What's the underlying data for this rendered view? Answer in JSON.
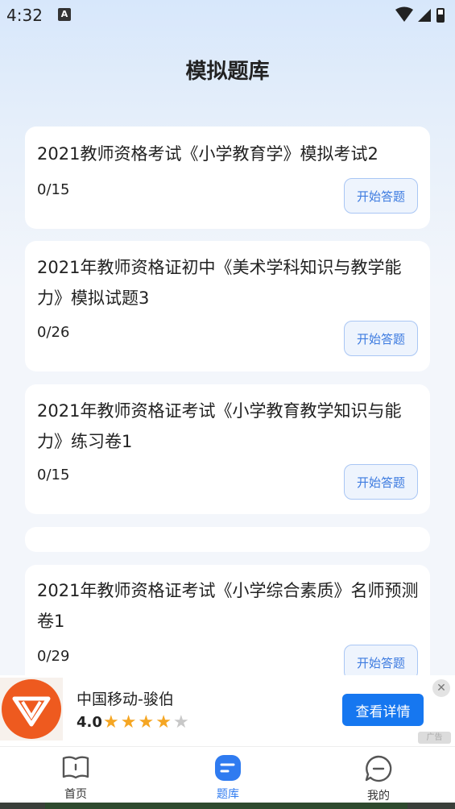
{
  "status_bar": {
    "time": "4:32",
    "notification_icon": "A"
  },
  "page": {
    "title": "模拟题库"
  },
  "cards": [
    {
      "title": "2021教师资格考试《小学教育学》模拟考试2",
      "progress": "0/15",
      "button": "开始答题"
    },
    {
      "title": "2021年教师资格证初中《美术学科知识与教学能力》模拟试题3",
      "progress": "0/26",
      "button": "开始答题"
    },
    {
      "title": "2021年教师资格证考试《小学教育教学知识与能力》练习卷1",
      "progress": "0/15",
      "button": "开始答题"
    },
    {
      "title": "2021年教师资格证考试《小学综合素质》名师预测卷1",
      "progress": "0/29",
      "button": "开始答题"
    }
  ],
  "ad": {
    "name": "中国移动-骏伯",
    "rating": "4.0",
    "stars_filled": 4,
    "stars_total": 5,
    "button": "查看详情",
    "close": "✕",
    "tag": "广告"
  },
  "tabbar": {
    "items": [
      {
        "label": "首页",
        "icon": "book-icon",
        "active": false
      },
      {
        "label": "题库",
        "icon": "question-bank-icon",
        "active": true
      },
      {
        "label": "我的",
        "icon": "chat-icon",
        "active": false
      }
    ]
  },
  "colors": {
    "accent": "#2f7bf0",
    "star": "#f5a623",
    "ad_button": "#1677f0"
  }
}
